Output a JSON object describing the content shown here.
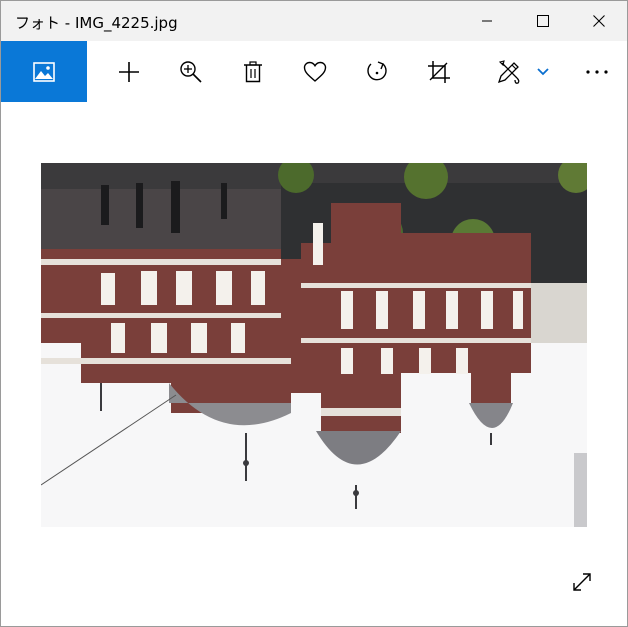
{
  "window": {
    "title": "フォト - IMG_4225.jpg",
    "controls": [
      "minimize",
      "maximize",
      "close"
    ]
  },
  "toolbar": {
    "app_icon": "photos-app-icon",
    "buttons": [
      {
        "name": "add",
        "icon": "plus-icon"
      },
      {
        "name": "zoom",
        "icon": "zoom-in-icon"
      },
      {
        "name": "delete",
        "icon": "trash-icon"
      },
      {
        "name": "favorite",
        "icon": "heart-icon"
      },
      {
        "name": "rotate",
        "icon": "rotate-icon"
      },
      {
        "name": "crop",
        "icon": "crop-icon"
      },
      {
        "name": "edit-create",
        "icon": "pencil-brush-icon",
        "dropdown": true
      },
      {
        "name": "more",
        "icon": "ellipsis-icon"
      }
    ]
  },
  "viewer": {
    "image": "upside-down photo of a red-brick building with white trim, domed towers and trees, against a white sky",
    "expand_icon": "expand-diagonal-icon"
  },
  "colors": {
    "accent": "#0a78d7",
    "titlebar": "#f2f2f2",
    "chevron": "#0a6fcf",
    "brick": "#7a3f3a"
  }
}
